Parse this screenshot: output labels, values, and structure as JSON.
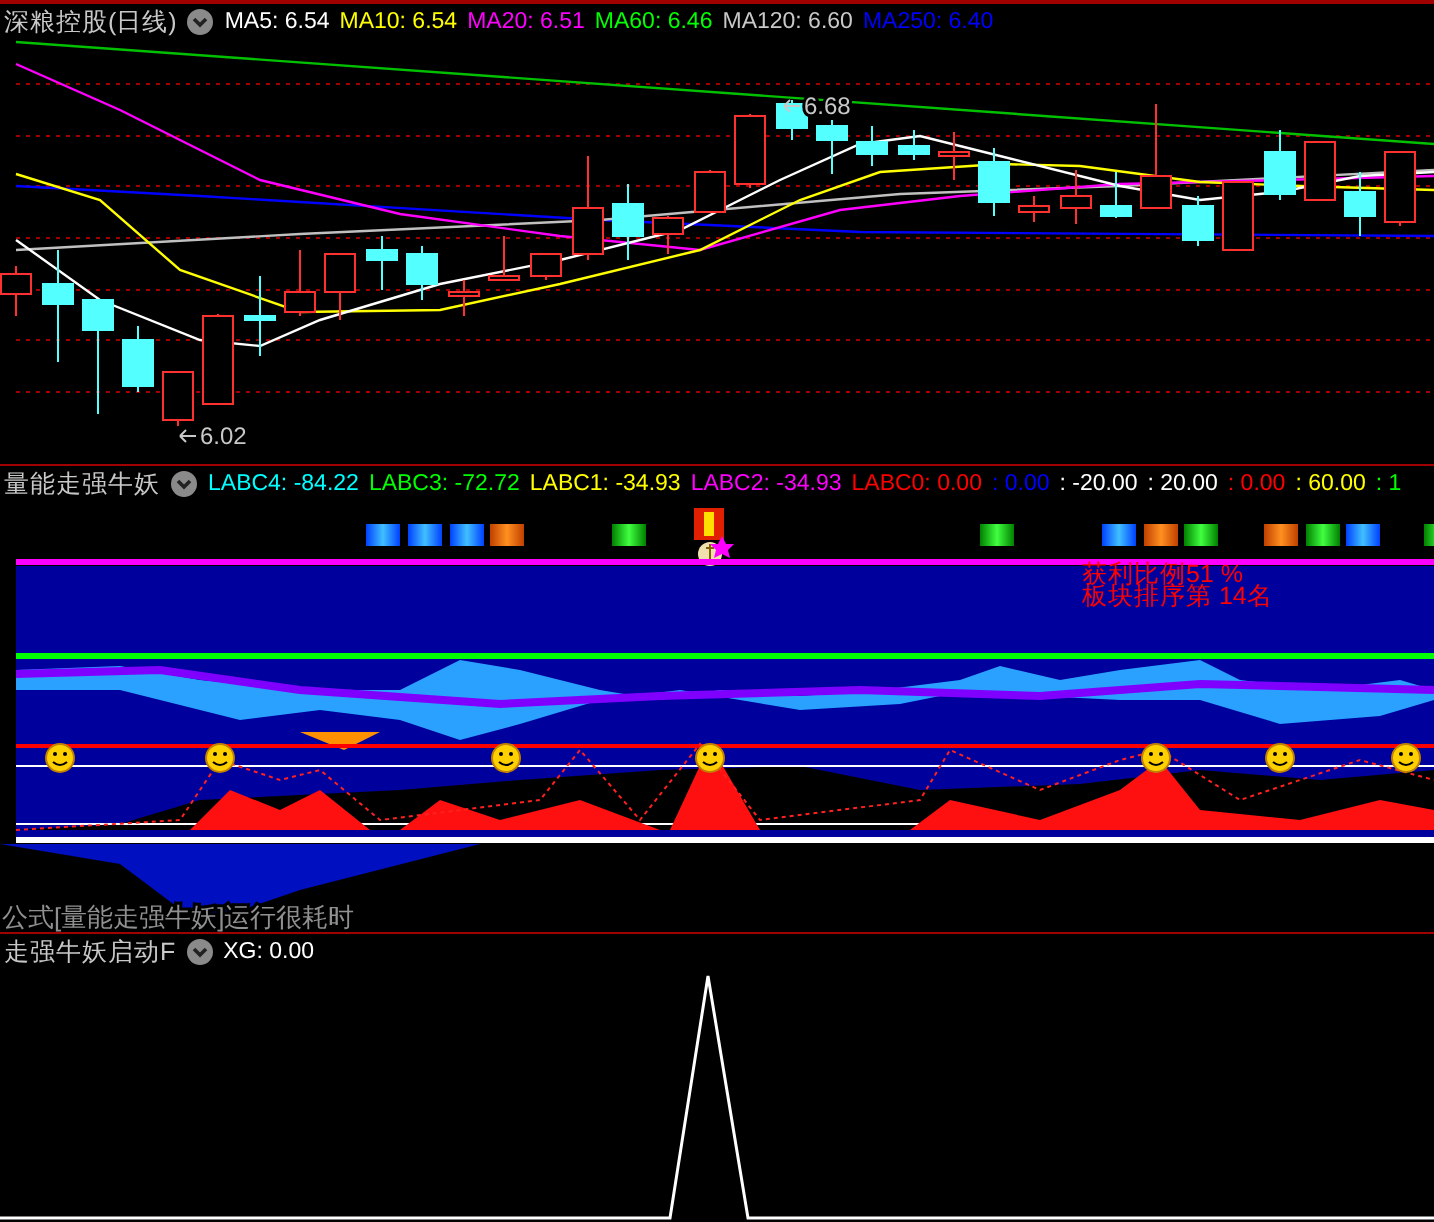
{
  "price_panel": {
    "title": "深粮控股(日线)",
    "indicators": [
      {
        "label": "MA5: 6.54",
        "color": "#ffffff"
      },
      {
        "label": "MA10: 6.54",
        "color": "#ffff00"
      },
      {
        "label": "MA20: 6.51",
        "color": "#ff00ff"
      },
      {
        "label": "MA60: 6.46",
        "color": "#00ff00"
      },
      {
        "label": "MA120: 6.60",
        "color": "#c8c8c8"
      },
      {
        "label": "MA250: 6.40",
        "color": "#0000ff"
      }
    ],
    "annotations": [
      {
        "kind": "high",
        "text": "6.68"
      },
      {
        "kind": "low",
        "text": "6.02"
      }
    ]
  },
  "indicator_panel": {
    "title": "量能走强牛妖",
    "values": [
      {
        "label": "LABC4: -84.22",
        "color": "#00ffff"
      },
      {
        "label": "LABC3: -72.72",
        "color": "#00ff00"
      },
      {
        "label": "LABC1: -34.93",
        "color": "#ffff00"
      },
      {
        "label": "LABC2: -34.93",
        "color": "#ff00ff"
      },
      {
        "label": "LABC0: 0.00",
        "color": "#ff0000"
      },
      {
        "label": ": 0.00",
        "color": "#0000ff"
      },
      {
        "label": ": -20.00",
        "color": "#ffffff"
      },
      {
        "label": ": 20.00",
        "color": "#ffffff"
      },
      {
        "label": ": 0.00",
        "color": "#ff0000"
      },
      {
        "label": ": 60.00",
        "color": "#ffff00"
      },
      {
        "label": ": 1",
        "color": "#00ff00"
      }
    ],
    "overlay_texts": [
      "获利比例51 %",
      "板块排序第 14名"
    ],
    "note": "公式[量能走强牛妖]运行很耗时"
  },
  "signal_panel": {
    "title": "走强牛妖启动F",
    "values": [
      {
        "label": "XG: 0.00",
        "color": "#ffffff"
      }
    ]
  }
}
